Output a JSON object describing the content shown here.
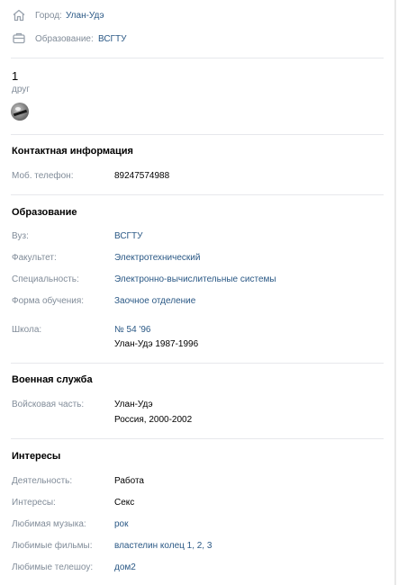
{
  "top": {
    "city_label": "Город:",
    "city_value": "Улан-Удэ",
    "edu_label": "Образование:",
    "edu_value": "ВСГТУ"
  },
  "friends": {
    "count": "1",
    "label": "друг"
  },
  "contacts": {
    "title": "Контактная информация",
    "phone_label": "Моб. телефон:",
    "phone_value": "89247574988"
  },
  "education": {
    "title": "Образование",
    "university_label": "Вуз:",
    "university_value": "ВСГТУ",
    "faculty_label": "Факультет:",
    "faculty_value": "Электротехнический",
    "speciality_label": "Специальность:",
    "speciality_value": "Электронно-вычислительные системы",
    "form_label": "Форма обучения:",
    "form_value": "Заочное отделение",
    "school_label": "Школа:",
    "school_value": "№ 54 '96",
    "school_detail": "Улан-Удэ 1987-1996"
  },
  "military": {
    "title": "Военная служба",
    "unit_label": "Войсковая часть:",
    "unit_value": "Улан-Удэ",
    "unit_detail": "Россия, 2000-2002"
  },
  "interests": {
    "title": "Интересы",
    "activity_label": "Деятельность:",
    "activity_value": "Работа",
    "interests_label": "Интересы:",
    "interests_value": "Секс",
    "music_label": "Любимая музыка:",
    "music_value": "рок",
    "movies_label": "Любимые фильмы:",
    "movies_value": "властелин колец 1, 2, 3",
    "tv_label": "Любимые телешоу:",
    "tv_value": "дом2"
  }
}
